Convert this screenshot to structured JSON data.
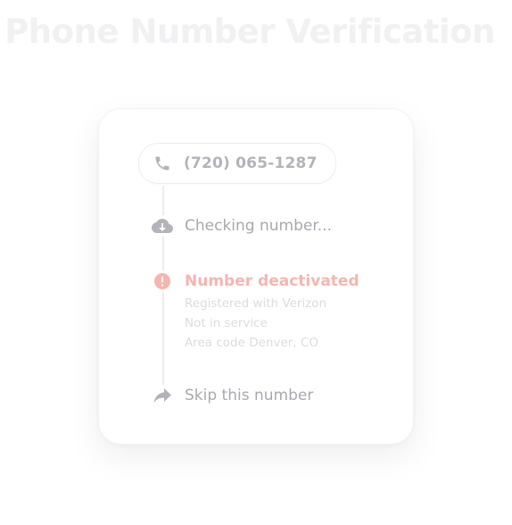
{
  "title": "Phone Number Verification",
  "phone": {
    "icon": "phone-icon",
    "number": "(720) 065-1287"
  },
  "steps": [
    {
      "icon": "cloud-download-icon",
      "label": "Checking number..."
    },
    {
      "icon": "alert-circle-icon",
      "label": "Number deactivated",
      "details": [
        "Registered with Verizon",
        "Not in service",
        "Area code Denver, CO"
      ]
    },
    {
      "icon": "share-arrow-icon",
      "label": "Skip this number"
    }
  ],
  "colors": {
    "muted_text": "#a8a8b0",
    "alert": "#f6b5ae",
    "detail_text": "#dcdce0",
    "title_text": "#f1f1f3"
  }
}
